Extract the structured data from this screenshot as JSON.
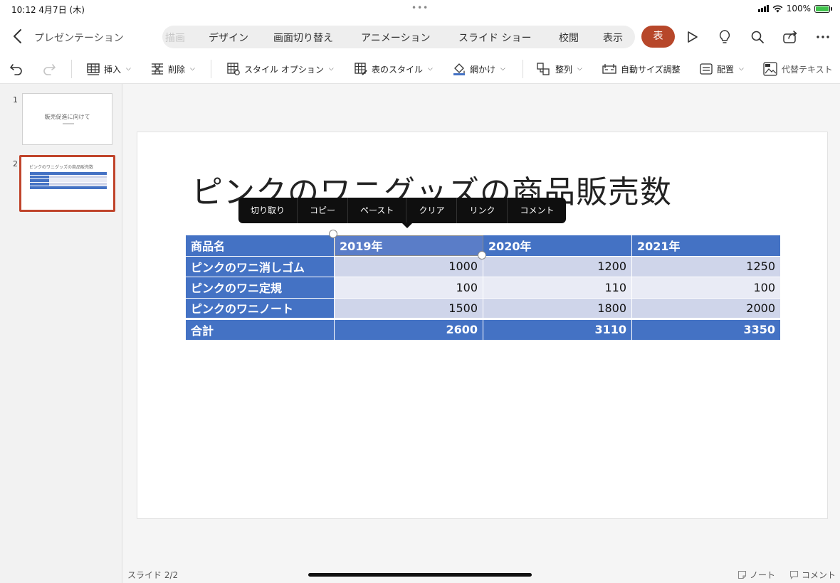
{
  "status": {
    "time": "10:12",
    "date": "4月7日 (木)",
    "battery": "100%"
  },
  "header": {
    "app_title": "プレゼンテーション",
    "tabs": [
      "描画",
      "デザイン",
      "画面切り替え",
      "アニメーション",
      "スライド ショー",
      "校閲",
      "表示"
    ],
    "active_tab": "表"
  },
  "toolbar": {
    "insert": "挿入",
    "delete": "削除",
    "style_options": "スタイル オプション",
    "table_styles": "表のスタイル",
    "shading": "網かけ",
    "arrange": "整列",
    "autofit": "自動サイズ調整",
    "align": "配置",
    "alt_text": "代替テキスト"
  },
  "thumbnails": [
    {
      "num": "1",
      "title": "販売促進に向けて"
    },
    {
      "num": "2",
      "title": "ピンクのワニグッズの商品販売数"
    }
  ],
  "slide": {
    "title": "ピンクのワニグッズの商品販売数",
    "table": {
      "headers": [
        "商品名",
        "2019年",
        "2020年",
        "2021年"
      ],
      "rows": [
        [
          "ピンクのワニ消しゴム",
          "1000",
          "1200",
          "1250"
        ],
        [
          "ピンクのワニ定規",
          "100",
          "110",
          "100"
        ],
        [
          "ピンクのワニノート",
          "1500",
          "1800",
          "2000"
        ]
      ],
      "total": [
        "合計",
        "2600",
        "3110",
        "3350"
      ]
    }
  },
  "context_menu": [
    "切り取り",
    "コピー",
    "ペースト",
    "クリア",
    "リンク",
    "コメント"
  ],
  "footer": {
    "slide_indicator": "スライド 2/2",
    "notes": "ノート",
    "comments": "コメント"
  },
  "colors": {
    "accent": "#b7472a",
    "table_header": "#4472c4",
    "row_odd": "#cfd5ea",
    "row_even": "#e9ebf5"
  }
}
